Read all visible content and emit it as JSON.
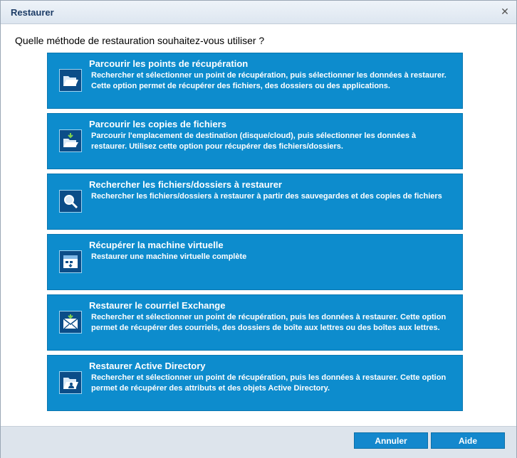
{
  "window": {
    "title": "Restaurer"
  },
  "question": "Quelle méthode de restauration souhaitez-vous utiliser ?",
  "options": [
    {
      "title": "Parcourir les points de récupération",
      "description": "Rechercher et sélectionner un point de récupération, puis sélectionner les données à restaurer. Cette option permet de récupérer des fichiers, des dossiers ou des applications.",
      "icon": "folder-open-icon"
    },
    {
      "title": "Parcourir les copies de fichiers",
      "description": "Parcourir l'emplacement de destination (disque/cloud), puis sélectionner les données à restaurer. Utilisez cette option pour récupérer des fichiers/dossiers.",
      "icon": "folder-download-icon"
    },
    {
      "title": "Rechercher les fichiers/dossiers à restaurer",
      "description": "Rechercher les fichiers/dossiers à restaurer à partir des sauvegardes et des copies de fichiers",
      "icon": "search-icon"
    },
    {
      "title": "Récupérer la machine virtuelle",
      "description": "Restaurer une machine virtuelle complète",
      "icon": "virtual-machine-icon"
    },
    {
      "title": "Restaurer le courriel Exchange",
      "description": "Rechercher et sélectionner un point de récupération, puis les données à restaurer. Cette option permet de récupérer des courriels, des dossiers de boîte aux lettres ou des boîtes aux lettres.",
      "icon": "exchange-mail-icon"
    },
    {
      "title": "Restaurer Active Directory",
      "description": "Rechercher et sélectionner un point de récupération, puis les données à restaurer. Cette option permet de récupérer des attributs et des objets Active Directory.",
      "icon": "active-directory-icon"
    }
  ],
  "footer": {
    "cancel_label": "Annuler",
    "help_label": "Aide"
  },
  "colors": {
    "option_bg": "#0d8ccd",
    "button_bg": "#1488cd",
    "title_text": "#1d3c66"
  }
}
